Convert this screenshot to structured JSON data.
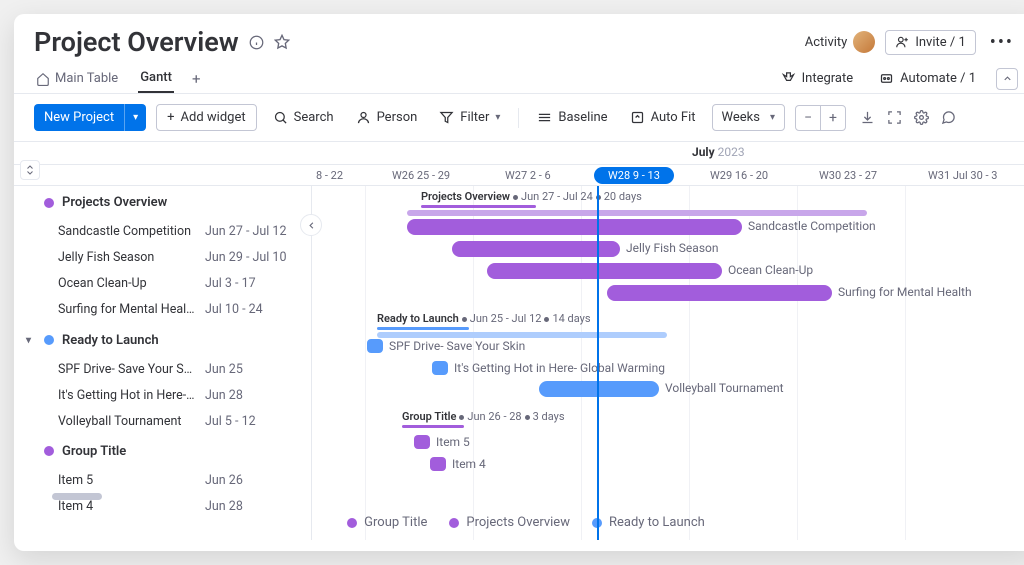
{
  "header": {
    "title": "Project Overview",
    "activity": "Activity",
    "invite": "Invite / 1"
  },
  "tabs": {
    "main": "Main Table",
    "gantt": "Gantt",
    "integrate": "Integrate",
    "automate": "Automate / 1"
  },
  "toolbar": {
    "new_project": "New Project",
    "add_widget": "Add widget",
    "search": "Search",
    "person": "Person",
    "filter": "Filter",
    "baseline": "Baseline",
    "auto_fit": "Auto Fit",
    "weeks": "Weeks"
  },
  "timeline": {
    "month": "July",
    "year": "2023",
    "weeks": [
      {
        "label": "8 - 22"
      },
      {
        "label": "W26 25 - 29"
      },
      {
        "label": "W27 2 - 6"
      },
      {
        "label": "W28 9 - 13"
      },
      {
        "label": "W29 16 - 20"
      },
      {
        "label": "W30 23 - 27"
      },
      {
        "label": "W31 Jul 30 - 3"
      }
    ]
  },
  "groups": [
    {
      "name": "Projects Overview",
      "color": "#a25ddc",
      "summary_range": "Jun 27 - Jul 24",
      "summary_days": "20 days",
      "items": [
        {
          "name": "Sandcastle Competition",
          "dates": "Jun 27 - Jul 12"
        },
        {
          "name": "Jelly Fish Season",
          "dates": "Jun 29 - Jul 10"
        },
        {
          "name": "Ocean Clean-Up",
          "dates": "Jul 3 - 17"
        },
        {
          "name": "Surfing for Mental Health",
          "dates": "Jul 10 - 24"
        }
      ]
    },
    {
      "name": "Ready to Launch",
      "color": "#579bfc",
      "summary_range": "Jun 25 - Jul 12",
      "summary_days": "14 days",
      "items": [
        {
          "name": "SPF Drive- Save Your Skin",
          "dates": "Jun 25"
        },
        {
          "name": "It's Getting Hot in Here- Glob…",
          "full": "It's Getting Hot in Here- Global Warming",
          "dates": "Jun 28"
        },
        {
          "name": "Volleyball Tournament",
          "dates": "Jul 5 - 12"
        }
      ]
    },
    {
      "name": "Group Title",
      "color": "#a25ddc",
      "summary_range": "Jun 26 - 28",
      "summary_days": "3 days",
      "items": [
        {
          "name": "Item 5",
          "dates": "Jun 26"
        },
        {
          "name": "Item 4",
          "dates": "Jun 28"
        }
      ]
    }
  ],
  "legend": [
    {
      "label": "Group Title",
      "color": "#a25ddc"
    },
    {
      "label": "Projects Overview",
      "color": "#a25ddc"
    },
    {
      "label": "Ready to Launch",
      "color": "#579bfc"
    }
  ]
}
